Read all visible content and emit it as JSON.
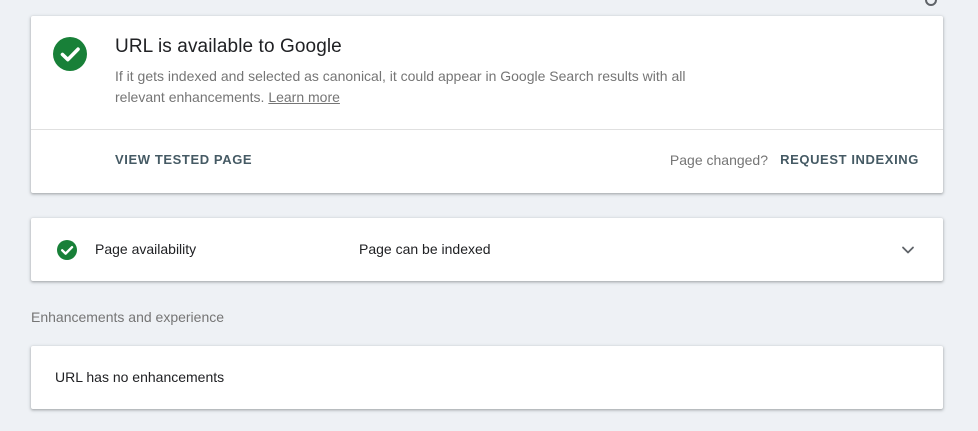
{
  "status": {
    "title": "URL is available to Google",
    "description": "If it gets indexed and selected as canonical, it could appear in Google Search results with all relevant enhancements.",
    "learn_more": "Learn more",
    "view_tested_page": "VIEW TESTED PAGE",
    "page_changed": "Page changed?",
    "request_indexing": "REQUEST INDEXING",
    "icon": "check-circle-icon"
  },
  "availability": {
    "label": "Page availability",
    "value": "Page can be indexed",
    "icon": "check-circle-icon",
    "expand_icon": "chevron-down-icon"
  },
  "enhancements": {
    "section_label": "Enhancements and experience",
    "message": "URL has no enhancements"
  },
  "colors": {
    "success": "#188038",
    "background": "#eef1f5",
    "action_text": "#455a64"
  }
}
